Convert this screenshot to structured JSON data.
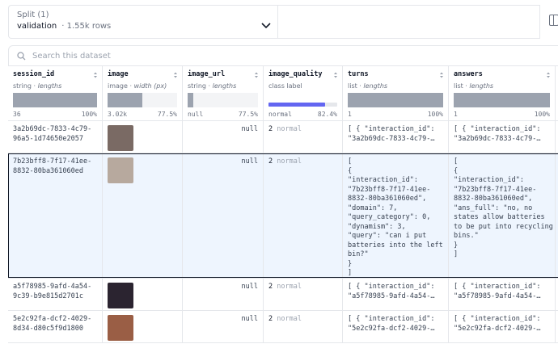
{
  "split": {
    "title": "Split (1)",
    "name": "validation",
    "separator": "·",
    "count": "1.55k rows"
  },
  "search": {
    "placeholder": "Search this dataset"
  },
  "columns": [
    {
      "name": "session_id",
      "type": "string",
      "sep": "·",
      "stat": "lengths",
      "min": "36",
      "max": "100%",
      "fill": 1.0
    },
    {
      "name": "image",
      "type": "image",
      "sep": "·",
      "stat": "width (px)",
      "min": "3.02k",
      "max": "77.5%",
      "fill": 0.5
    },
    {
      "name": "image_url",
      "type": "string",
      "sep": "·",
      "stat": "lengths",
      "min": "null",
      "max": "77.5%",
      "fill": 0.08
    },
    {
      "name": "image_quality",
      "type": "class label",
      "sep": "",
      "stat": "",
      "min": "normal",
      "max": "82.4%",
      "fill": 0.82
    },
    {
      "name": "turns",
      "type": "list",
      "sep": "·",
      "stat": "lengths",
      "min": "1",
      "max": "100%",
      "fill": 1.0
    },
    {
      "name": "answers",
      "type": "list",
      "sep": "·",
      "stat": "lengths",
      "min": "1",
      "max": "100%",
      "fill": 1.0
    }
  ],
  "rows": [
    {
      "session_id": "3a2b69dc-7833-4c79-\n96a5-1d74650e2057",
      "image_url": "null",
      "quality_num": "2",
      "quality_label": "normal",
      "turns": "[ { \"interaction_id\":\n\"3a2b69dc-7833-4c79-…",
      "answers": "[ { \"interaction_id\":\n\"3a2b69dc-7833-4c79-…",
      "thumb_color": "#7a6a64"
    },
    {
      "session_id": "7b23bff8-7f17-41ee-\n8832-80ba361060ed",
      "image_url": "null",
      "quality_num": "2",
      "quality_label": "normal",
      "turns": "[\n{\n\"interaction_id\":\n\"7b23bff8-7f17-41ee-\n8832-80ba361060ed\",\n\"domain\": 7,\n\"query_category\": 0,\n\"dynamism\": 3,\n\"query\": \"can i put\nbatteries into the left\nbin?\"\n}\n]",
      "answers": "[\n{\n\"interaction_id\":\n\"7b23bff8-7f17-41ee-\n8832-80ba361060ed\",\n\"ans_full\": \"no, no\nstates allow batteries\nto be put into recycling\nbins.\"\n}\n]",
      "thumb_color": "#b7a99e"
    },
    {
      "session_id": "a5f78985-9afd-4a54-\n9c39-b9e815d2701c",
      "image_url": "null",
      "quality_num": "2",
      "quality_label": "normal",
      "turns": "[ { \"interaction_id\":\n\"a5f78985-9afd-4a54-…",
      "answers": "[ { \"interaction_id\":\n\"a5f78985-9afd-4a54-…",
      "thumb_color": "#2b2430"
    },
    {
      "session_id": "5e2c92fa-dcf2-4029-\n8d34-d80c5f9d1800",
      "image_url": "null",
      "quality_num": "2",
      "quality_label": "normal",
      "turns": "[ { \"interaction_id\":\n\"5e2c92fa-dcf2-4029-…",
      "answers": "[ { \"interaction_id\":\n\"5e2c92fa-dcf2-4029-…",
      "thumb_color": "#9a5e45"
    }
  ],
  "colors": {
    "accent": "#6366f1",
    "selected_bg": "#eef5fe"
  }
}
